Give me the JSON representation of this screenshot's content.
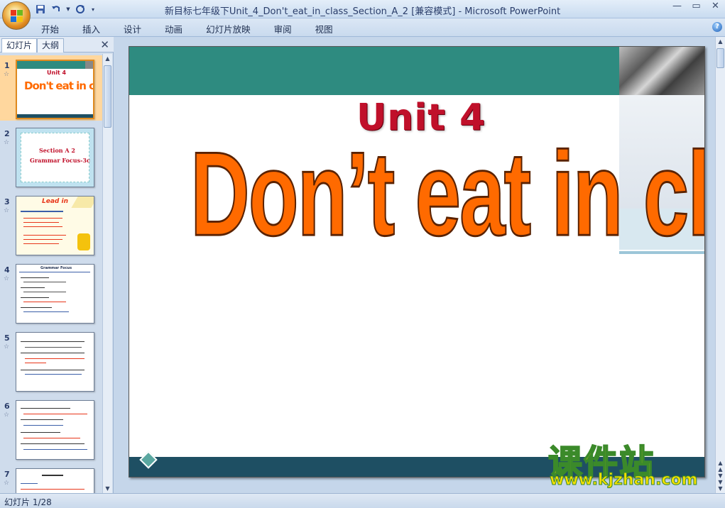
{
  "window": {
    "title": "新目标七年级下Unit_4_Don't_eat_in_class_Section_A_2 [兼容模式] - Microsoft PowerPoint",
    "minimize": "—",
    "restore": "▭",
    "close": "✕"
  },
  "ribbon": {
    "tabs": [
      "开始",
      "插入",
      "设计",
      "动画",
      "幻灯片放映",
      "审阅",
      "视图"
    ]
  },
  "pane": {
    "tab_slides": "幻灯片",
    "tab_outline": "大纲",
    "close": "✕",
    "thumbnails": [
      {
        "num": "1",
        "title": "Unit 4",
        "subtitle": "Don't eat in class."
      },
      {
        "num": "2",
        "title": "Section A 2",
        "subtitle": "Grammar Focus-3c"
      },
      {
        "num": "3",
        "title": "Lead in"
      },
      {
        "num": "4",
        "title": "Grammar Focus"
      },
      {
        "num": "5"
      },
      {
        "num": "6"
      },
      {
        "num": "7"
      }
    ]
  },
  "slide": {
    "unit": "Unit 4",
    "title": "Don’t  eat in class."
  },
  "watermark": {
    "main": "课件站",
    "url": "www.kjzhan.com"
  },
  "status": {
    "text": "幻灯片 1/28"
  },
  "colors": {
    "teal": "#2e8b80",
    "orange_title": "#ff6a00",
    "red_unit": "#c0102a",
    "selected_thumb": "#ffd79e"
  }
}
